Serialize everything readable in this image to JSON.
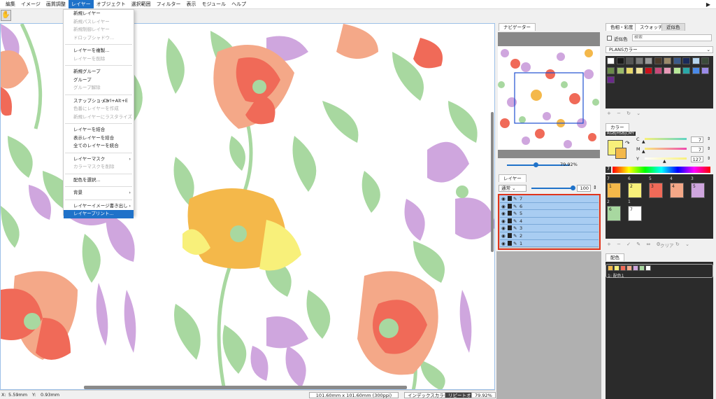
{
  "menubar": {
    "items": [
      "編集",
      "イメージ",
      "画質調整",
      "レイヤー",
      "オブジェクト",
      "選択範囲",
      "フィルター",
      "表示",
      "モジュール",
      "ヘルプ"
    ],
    "active_index": 3
  },
  "layer_menu": {
    "items": [
      {
        "label": "新規レイヤー",
        "disabled": false
      },
      {
        "label": "新規パスレイヤー",
        "disabled": true
      },
      {
        "label": "新規制御レイヤー",
        "disabled": true
      },
      {
        "label": "ドロップシャドウ...",
        "disabled": true
      },
      {
        "sep": true
      },
      {
        "label": "レイヤーを複製...",
        "disabled": false
      },
      {
        "label": "レイヤーを削除",
        "disabled": true
      },
      {
        "sep": true
      },
      {
        "label": "新規グループ",
        "disabled": false
      },
      {
        "label": "グループ",
        "disabled": false
      },
      {
        "label": "グループ解除",
        "disabled": true
      },
      {
        "sep": true
      },
      {
        "label": "スナップショット",
        "shortcut": "Ctrl+Alt+E",
        "disabled": false
      },
      {
        "label": "色番にレイヤーを作成",
        "disabled": true
      },
      {
        "label": "新規レイヤーにラスタライズ",
        "disabled": true
      },
      {
        "sep": true
      },
      {
        "label": "レイヤーを結合",
        "disabled": false
      },
      {
        "label": "表示レイヤーを結合",
        "disabled": false
      },
      {
        "label": "全てのレイヤーを統合",
        "disabled": false
      },
      {
        "sep": true
      },
      {
        "label": "レイヤーマスク",
        "submenu": true,
        "disabled": false
      },
      {
        "label": "カラーマスクを削除",
        "disabled": true
      },
      {
        "sep": true
      },
      {
        "label": "配色を選択...",
        "disabled": false
      },
      {
        "sep": true
      },
      {
        "label": "背景",
        "submenu": true,
        "disabled": false
      },
      {
        "sep": true
      },
      {
        "label": "レイヤーイメージ書き出し",
        "submenu": true,
        "disabled": false
      },
      {
        "label": "レイヤープリント...",
        "disabled": false,
        "highlight": true
      }
    ]
  },
  "status": {
    "x_label": "X:",
    "x_value": "5.59mm",
    "y_label": "Y:",
    "y_value": "0.93mm",
    "size": "101.60mm x 101.60mm (300ppi)",
    "mode": "インデックスカラー",
    "repeat": "リピートオン",
    "zoom": "79.92%"
  },
  "navigator": {
    "tab": "ナビゲーター",
    "zoom": "79.92%"
  },
  "layers": {
    "tab": "レイヤー",
    "blend": "通常",
    "opacity": "100",
    "items": [
      "7",
      "6",
      "5",
      "4",
      "3",
      "2",
      "1"
    ]
  },
  "color_panel": {
    "tabs": [
      "色相・彩度",
      "スウォッチ",
      "近似色"
    ],
    "active_tab": 1,
    "approx_label": "近似色",
    "search_placeholder": "検索",
    "palette_name": "PLANSカラー",
    "color_tab": "カラー",
    "mode_buttons": [
      "RGB",
      "HSB",
      "CMY"
    ],
    "channels": [
      {
        "label": "C",
        "value": "7"
      },
      {
        "label": "M",
        "value": "7"
      },
      {
        "label": "Y",
        "value": "127"
      }
    ],
    "index_label": "7",
    "clear_label": "クリア",
    "haishoku_tab": "配色",
    "haishoku_name": "1: 配色1"
  },
  "swatches": [
    "#ffffff",
    "#1a1a1a",
    "#555555",
    "#7a7a7a",
    "#9a9a9a",
    "#4a3a2a",
    "#9b8a6a",
    "#3a5a8a",
    "#1a2a5a",
    "#b5d4ee",
    "#3a4a3a",
    "#6a8a4a",
    "#9aba6a",
    "#e8d86a",
    "#f2e49a",
    "#c8101a",
    "#c84a7a",
    "#e89ab8",
    "#b8e89a",
    "#2aa8a8",
    "#4a8ae8",
    "#9a8ae8",
    "#6a2a8a"
  ],
  "index_colors": [
    {
      "num": "7",
      "idx": "1",
      "color": "#f4b84a"
    },
    {
      "num": "6",
      "idx": "2",
      "color": "#f8f07a"
    },
    {
      "num": "5",
      "idx": "3",
      "color": "#f06a58"
    },
    {
      "num": "4",
      "idx": "4",
      "color": "#f4a888"
    },
    {
      "num": "3",
      "idx": "5",
      "color": "#cfa6de"
    },
    {
      "num": "2",
      "idx": "6",
      "color": "#a8d8a0"
    },
    {
      "num": "1",
      "idx": "7",
      "color": "#ffffff"
    }
  ],
  "haishoku_colors": [
    "#f4b84a",
    "#f8f07a",
    "#f06a58",
    "#f4a888",
    "#cfa6de",
    "#a8d8a0",
    "#ffffff"
  ]
}
